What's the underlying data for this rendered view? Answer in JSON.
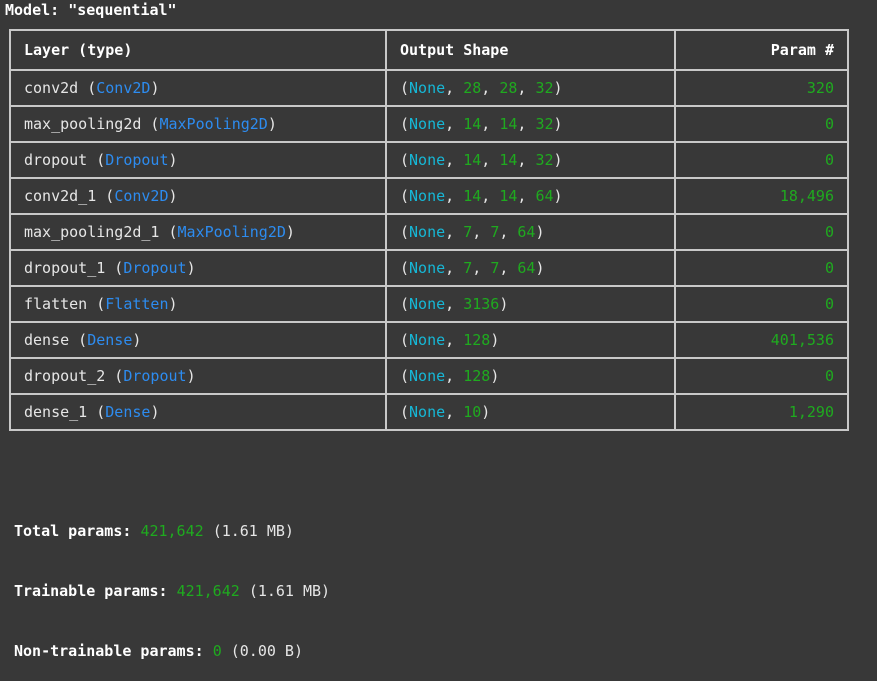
{
  "model_title": "Model: \"sequential\"",
  "headers": {
    "layer": "Layer (type)",
    "output_shape": "Output Shape",
    "params": "Param #"
  },
  "rows": [
    {
      "name": "conv2d",
      "type": "Conv2D",
      "shape": [
        "None",
        "28",
        "28",
        "32"
      ],
      "params": "320"
    },
    {
      "name": "max_pooling2d",
      "type": "MaxPooling2D",
      "shape": [
        "None",
        "14",
        "14",
        "32"
      ],
      "params": "0"
    },
    {
      "name": "dropout",
      "type": "Dropout",
      "shape": [
        "None",
        "14",
        "14",
        "32"
      ],
      "params": "0"
    },
    {
      "name": "conv2d_1",
      "type": "Conv2D",
      "shape": [
        "None",
        "14",
        "14",
        "64"
      ],
      "params": "18,496"
    },
    {
      "name": "max_pooling2d_1",
      "type": "MaxPooling2D",
      "shape": [
        "None",
        "7",
        "7",
        "64"
      ],
      "params": "0"
    },
    {
      "name": "dropout_1",
      "type": "Dropout",
      "shape": [
        "None",
        "7",
        "7",
        "64"
      ],
      "params": "0"
    },
    {
      "name": "flatten",
      "type": "Flatten",
      "shape": [
        "None",
        "3136"
      ],
      "params": "0"
    },
    {
      "name": "dense",
      "type": "Dense",
      "shape": [
        "None",
        "128"
      ],
      "params": "401,536"
    },
    {
      "name": "dropout_2",
      "type": "Dropout",
      "shape": [
        "None",
        "128"
      ],
      "params": "0"
    },
    {
      "name": "dense_1",
      "type": "Dense",
      "shape": [
        "None",
        "10"
      ],
      "params": "1,290"
    }
  ],
  "totals": {
    "total": {
      "label": "Total params:",
      "value": "421,642",
      "size": "(1.61 MB)"
    },
    "trainable": {
      "label": "Trainable params:",
      "value": "421,642",
      "size": "(1.61 MB)"
    },
    "non_trainable": {
      "label": "Non-trainable params:",
      "value": "0",
      "size": "(0.00 B)"
    }
  },
  "colors": {
    "background": "#383838",
    "layer_type": "#2d8cf0",
    "none_keyword": "#16b7d6",
    "number": "#1faa1f",
    "border": "#c8c8c8"
  }
}
